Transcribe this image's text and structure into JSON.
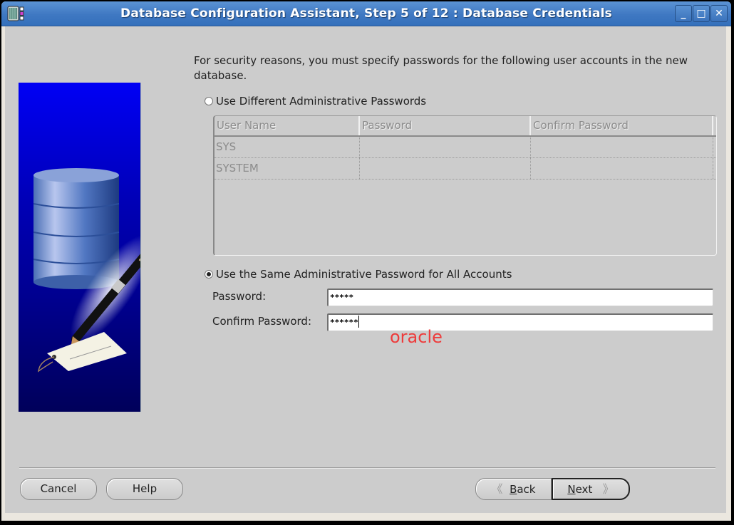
{
  "window": {
    "title": "Database Configuration Assistant, Step 5 of 12 : Database Credentials",
    "app_icon": "oracle-dbca-icon",
    "controls": {
      "minimize_icon": "minimize-icon",
      "maximize_icon": "maximize-icon",
      "close_icon": "close-icon",
      "minimize_glyph": "_",
      "maximize_glyph": "□",
      "close_glyph": "✕"
    }
  },
  "sidebar": {
    "image": "database-pen-tag-illustration"
  },
  "main": {
    "intro_text": "For security reasons, you must specify passwords for the following user accounts in the new database.",
    "option_different": {
      "label": "Use Different Administrative Passwords",
      "selected": false
    },
    "accounts_table": {
      "enabled": false,
      "columns": [
        "User Name",
        "Password",
        "Confirm Password"
      ],
      "rows": [
        {
          "user": "SYS",
          "password": "",
          "confirm": ""
        },
        {
          "user": "SYSTEM",
          "password": "",
          "confirm": ""
        }
      ]
    },
    "option_same": {
      "label": "Use the Same Administrative Password for All Accounts",
      "selected": true
    },
    "password_label": "Password:",
    "password_value": "*****",
    "confirm_label": "Confirm Password:",
    "confirm_value": "******",
    "annotation": "oracle",
    "annotation_color": "#ee3b3b"
  },
  "buttons": {
    "cancel": "Cancel",
    "help": "Help",
    "back_mnemonic": "B",
    "back_rest": "ack",
    "next_mnemonic": "N",
    "next_rest": "ext",
    "back_icon_glyph": "《",
    "next_icon_glyph": "》"
  },
  "colors": {
    "titlebar": "#3f78c2",
    "dialog_background": "#cccccc",
    "annotation": "#ee3b3b"
  }
}
